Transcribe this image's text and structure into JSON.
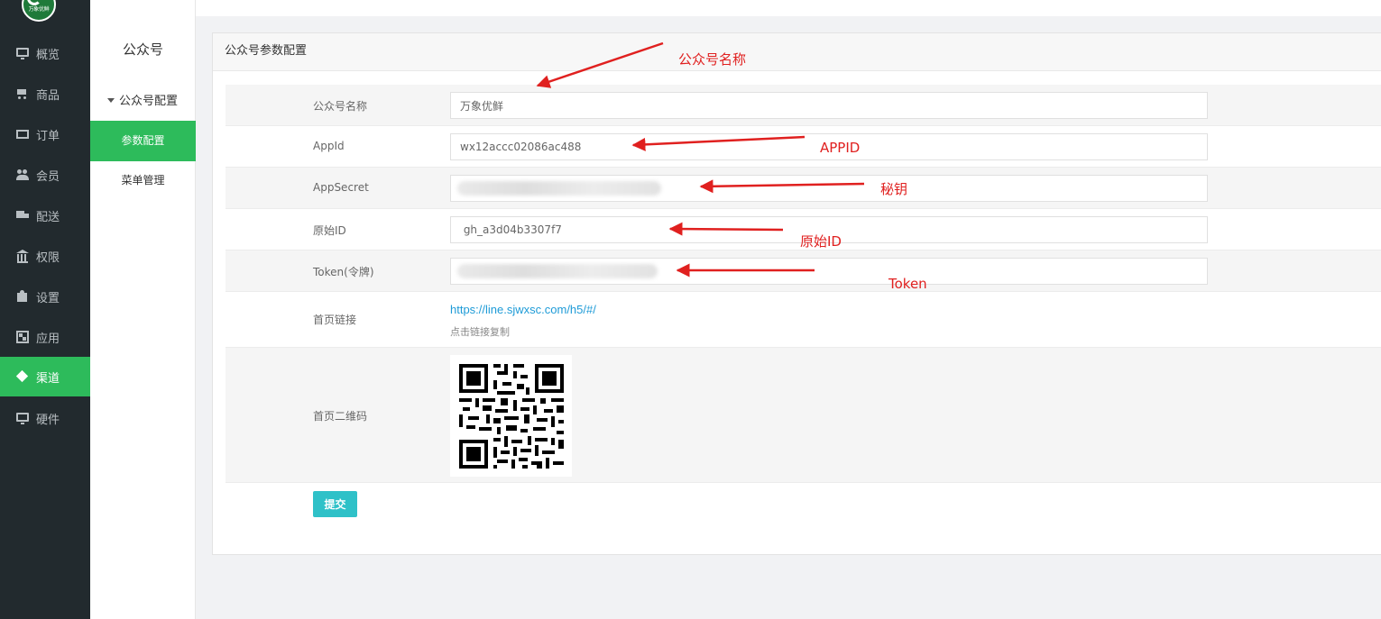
{
  "nav": {
    "logo_text": "万象优鲜",
    "items": [
      {
        "label": "概览",
        "icon": "monitor-icon"
      },
      {
        "label": "商品",
        "icon": "cart-icon"
      },
      {
        "label": "订单",
        "icon": "ticket-icon"
      },
      {
        "label": "会员",
        "icon": "users-icon"
      },
      {
        "label": "配送",
        "icon": "truck-icon"
      },
      {
        "label": "权限",
        "icon": "bank-icon"
      },
      {
        "label": "设置",
        "icon": "puzzle-icon"
      },
      {
        "label": "应用",
        "icon": "apps-icon"
      },
      {
        "label": "渠道",
        "icon": "cube-icon",
        "active": true
      },
      {
        "label": "硬件",
        "icon": "desktop-icon"
      }
    ],
    "active_color": "#2dbb5b"
  },
  "subnav": {
    "title": "公众号",
    "group": "公众号配置",
    "items": [
      {
        "label": "参数配置",
        "active": true
      },
      {
        "label": "菜单管理"
      }
    ]
  },
  "panel": {
    "title": "公众号参数配置",
    "fields": [
      {
        "label": "公众号名称",
        "value": "万象优鲜"
      },
      {
        "label": "AppId",
        "value": "wx12accc02086ac488"
      },
      {
        "label": "AppSecret",
        "value": "",
        "obscured": true
      },
      {
        "label": "原始ID",
        "value": " gh_a3d04b3307f7"
      },
      {
        "label": "Token(令牌)",
        "value": "",
        "obscured": true
      }
    ],
    "home_link": {
      "label": "首页链接",
      "url": "https://line.sjwxsc.com/h5/#/",
      "tip": "点击链接复制"
    },
    "qr": {
      "label": "首页二维码"
    },
    "submit_label": "提交",
    "submit_color": "#2fc1c8"
  },
  "annotations": {
    "name": "公众号名称",
    "appid": "APPID",
    "secret": "秘钥",
    "origin_id": "原始ID",
    "token": "Token",
    "color": "#e0201f"
  }
}
